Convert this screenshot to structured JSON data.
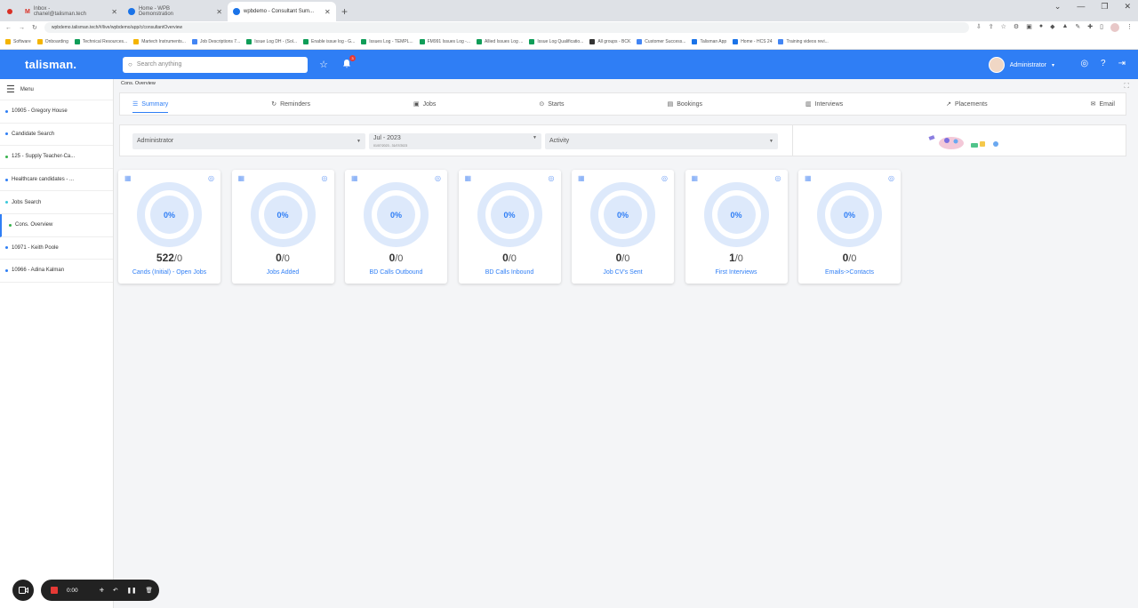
{
  "browser": {
    "tabs": [
      {
        "title": "Inbox - chanel@talisman.tech",
        "favicon_color": "#d93025"
      },
      {
        "title": "Home - WPB Demonstration",
        "favicon_color": "#1a73e8"
      },
      {
        "title": "wpbdemo - Consultant Sum...",
        "favicon_color": "#1a73e8"
      }
    ],
    "new_tab": "+",
    "url": "wpbdemo.talisman.tech/#/live/wpbdemo/app/c/consultantOverview",
    "bookmarks": [
      "Software",
      "Onboarding",
      "Technical Resources...",
      "Martech Instruments...",
      "Job Descriptions 7...",
      "Issue Log DH - (Sol...",
      "Enable issue log - G...",
      "Issues Log - TEMPL...",
      "FM991 Issues Log -...",
      "Allied Issues Log ...",
      "Issue Log Qualificatio...",
      "All groups - BCK",
      "Customer Success...",
      "Talisman App",
      "Home - HCS 24",
      "Training videos revi..."
    ]
  },
  "app": {
    "logo": "talisman.",
    "search_placeholder": "Search anything",
    "notification_count": "3",
    "user_name": "Administrator",
    "accent_color": "#2f7ef5"
  },
  "sidebar": {
    "menu_label": "Menu",
    "items": [
      {
        "label": "10905 - Gregory House"
      },
      {
        "label": "Candidate Search"
      },
      {
        "label": "125 - Supply Teacher-Ca..."
      },
      {
        "label": "Healthcare candidates - ..."
      },
      {
        "label": "Jobs Search"
      },
      {
        "label": "Cons. Overview"
      },
      {
        "label": "10971 - Keith Poole"
      },
      {
        "label": "10966 - Adina Kalman"
      }
    ]
  },
  "main": {
    "breadcrumb": "Cons. Overview",
    "tabs": [
      {
        "label": "Summary",
        "icon": "list-icon"
      },
      {
        "label": "Reminders",
        "icon": "reminder-icon"
      },
      {
        "label": "Jobs",
        "icon": "briefcase-icon"
      },
      {
        "label": "Starts",
        "icon": "play-icon"
      },
      {
        "label": "Bookings",
        "icon": "calendar-icon"
      },
      {
        "label": "Interviews",
        "icon": "clipboard-icon"
      },
      {
        "label": "Placements",
        "icon": "handshake-icon"
      },
      {
        "label": "Email",
        "icon": "mail-icon"
      }
    ],
    "filters": {
      "consultant": "Administrator",
      "period": "Jul - 2023",
      "period_range": "01/07/2023 - 31/07/2023",
      "type": "Activity"
    },
    "cards": [
      {
        "percent": "0%",
        "value": "522",
        "target": "/0",
        "label": "Cands (Initial) - Open Jobs"
      },
      {
        "percent": "0%",
        "value": "0",
        "target": "/0",
        "label": "Jobs Added"
      },
      {
        "percent": "0%",
        "value": "0",
        "target": "/0",
        "label": "BD Calls Outbound"
      },
      {
        "percent": "0%",
        "value": "0",
        "target": "/0",
        "label": "BD Calls Inbound"
      },
      {
        "percent": "0%",
        "value": "0",
        "target": "/0",
        "label": "Job CV's Sent"
      },
      {
        "percent": "0%",
        "value": "1",
        "target": "/0",
        "label": "First Interviews"
      },
      {
        "percent": "0%",
        "value": "0",
        "target": "/0",
        "label": "Emails->Contacts"
      }
    ]
  },
  "recorder": {
    "time": "0:00"
  }
}
